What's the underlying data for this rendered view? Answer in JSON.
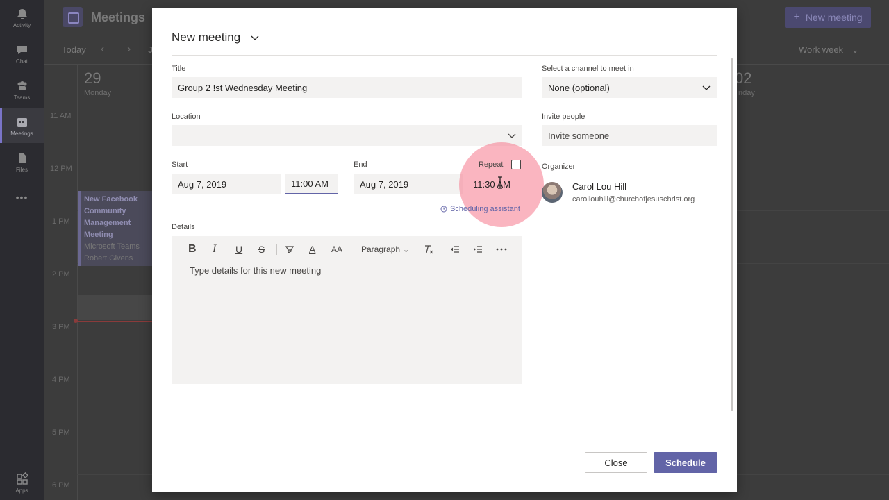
{
  "rail": {
    "items": [
      {
        "label": "Activity",
        "icon": "bell-icon"
      },
      {
        "label": "Chat",
        "icon": "chat-icon"
      },
      {
        "label": "Teams",
        "icon": "teams-icon"
      },
      {
        "label": "Meetings",
        "icon": "calendar-icon"
      },
      {
        "label": "Files",
        "icon": "file-icon"
      }
    ],
    "more": "•••",
    "apps_label": "Apps"
  },
  "background": {
    "page_title": "Meetings",
    "new_meeting": "New meeting",
    "today": "Today",
    "month_fragment": "J",
    "view_mode": "Work week",
    "day_number": "29",
    "day_name": "Monday",
    "day_number_right": "02",
    "day_name_right": "riday",
    "times": [
      "11 AM",
      "12 PM",
      "1 PM",
      "2 PM",
      "3 PM",
      "4 PM",
      "5 PM",
      "6 PM"
    ],
    "event": {
      "title_lines": [
        "New Facebook",
        "Community",
        "Management",
        "Meeting"
      ],
      "location": "Microsoft Teams",
      "organizer": "Robert Givens"
    }
  },
  "dialog": {
    "title": "New meeting",
    "title_label": "Title",
    "title_value": "Group 2 !st Wednesday Meeting",
    "location_label": "Location",
    "location_value": "",
    "start_label": "Start",
    "start_date": "Aug 7, 2019",
    "start_time": "11:00 AM",
    "end_label": "End",
    "end_date": "Aug 7, 2019",
    "end_time": "11:30 AM",
    "repeat_label": "Repeat",
    "scheduling_assistant": "Scheduling assistant",
    "details_label": "Details",
    "details_placeholder": "Type details for this new meeting",
    "toolbar": {
      "bold": "B",
      "italic": "I",
      "underline": "U",
      "strike": "S",
      "font_color": "A",
      "font_size": "AA",
      "paragraph": "Paragraph"
    },
    "channel_label": "Select a channel to meet in",
    "channel_value": "None (optional)",
    "invite_label": "Invite people",
    "invite_placeholder": "Invite someone",
    "organizer_label": "Organizer",
    "organizer_name": "Carol Lou Hill",
    "organizer_email": "carollouhill@churchofjesuschrist.org",
    "close_button": "Close",
    "schedule_button": "Schedule"
  },
  "colors": {
    "accent": "#6264a7",
    "field_bg": "#f3f2f1",
    "highlight": "#f5788c"
  }
}
